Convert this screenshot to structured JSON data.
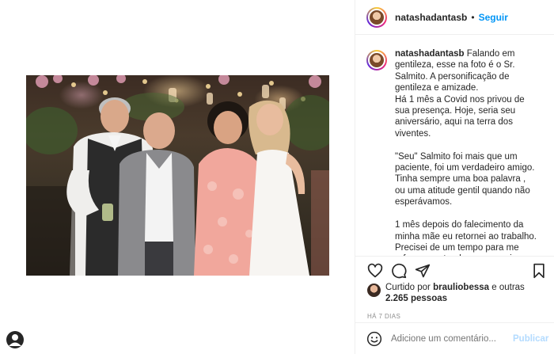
{
  "post": {
    "username": "natashadantasb",
    "follow_label": "Seguir",
    "dot": "•"
  },
  "caption": {
    "username": "natashadantasb",
    "text": " Falando em gentileza, esse na foto é o Sr. Salmito. A personificação de gentileza e amizade.\nHá 1 mês a Covid nos privou de sua presença. Hoje, seria seu aniversário, aqui na terra dos viventes.\n\n\"Seu\" Salmito foi mais que um paciente, foi um verdadeiro amigo. Tinha sempre uma boa palavra , ou uma atitude gentil quando não esperávamos.\n\n1 mês depois do falecimento da minha mãe eu retornei ao trabalho. Precisei de um tempo para me refazer e entender o que seria minha vida sem ela. Em um dia de trabalho, antes"
  },
  "likes": {
    "prefix": "Curtido por ",
    "liker": "brauliobessa",
    "middle": " e outras ",
    "count": "2.265",
    "suffix": " pessoas"
  },
  "time_ago": "HÁ 7 DIAS",
  "comment": {
    "placeholder": "Adicione um comentário...",
    "publish_label": "Publicar"
  },
  "icons": {
    "like": "heart-icon",
    "comment": "comment-icon",
    "share": "send-icon",
    "save": "bookmark-icon",
    "emoji": "emoji-icon"
  },
  "colors": {
    "link_blue": "#0095f6",
    "publish_disabled": "#b3dbff",
    "muted": "#8e8e8e",
    "text": "#262626",
    "border": "#efefef"
  }
}
